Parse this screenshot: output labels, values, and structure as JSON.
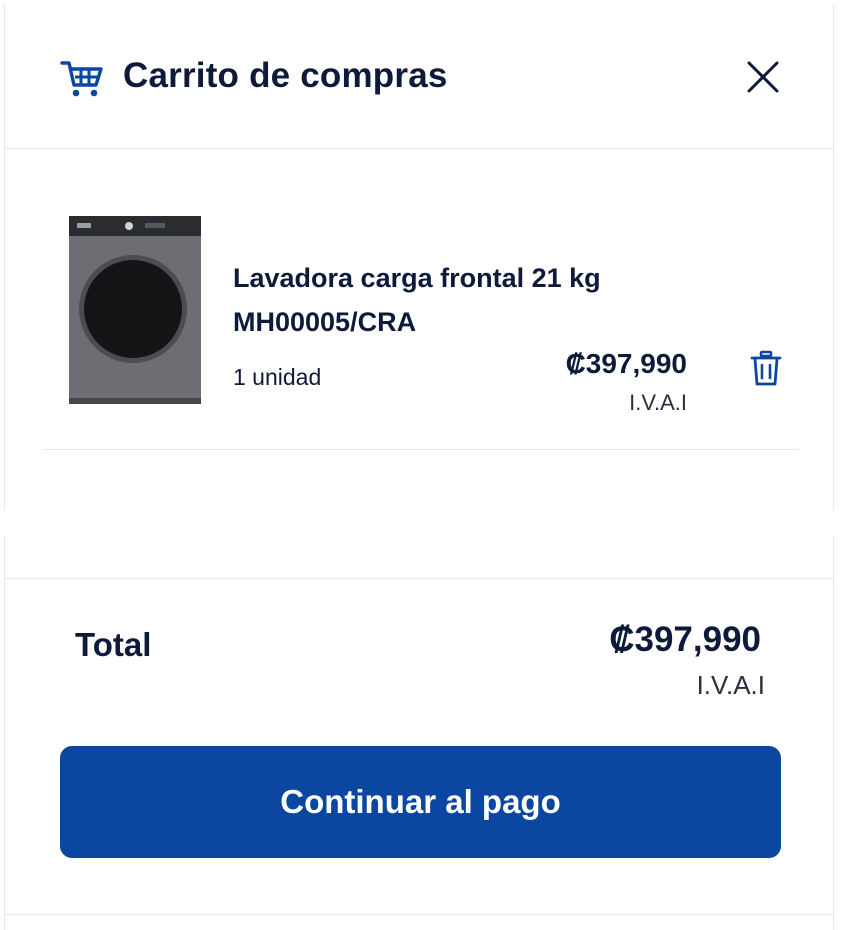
{
  "header": {
    "title": "Carrito de compras"
  },
  "cart": {
    "items": [
      {
        "name": "Lavadora carga frontal 21 kg MH00005/CRA",
        "quantity_text": "1 unidad",
        "price": "₡397,990",
        "tax_label": "I.V.A.I"
      }
    ]
  },
  "summary": {
    "total_label": "Total",
    "total_price": "₡397,990",
    "tax_label": "I.V.A.I"
  },
  "actions": {
    "checkout_label": "Continuar al pago"
  },
  "colors": {
    "primary": "#0b47a0",
    "text": "#0e1a3a",
    "border": "#e4e6ec"
  },
  "icons": {
    "cart": "shopping-cart-icon",
    "close": "close-icon",
    "trash": "trash-icon"
  }
}
